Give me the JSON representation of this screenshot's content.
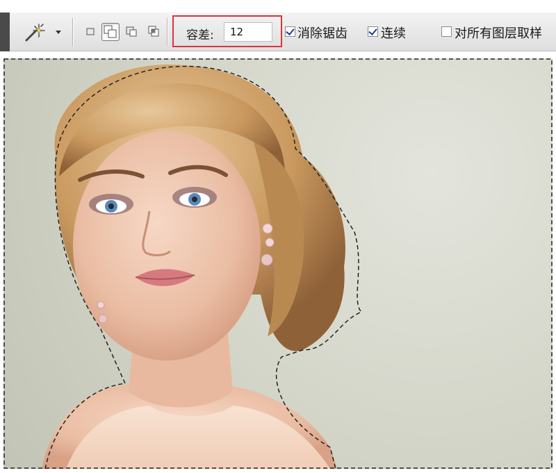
{
  "options_bar": {
    "tool_icon": "magic-wand-icon",
    "dropdown_icon": "chevron-down-icon",
    "selection_modes": [
      {
        "name": "new-selection",
        "active": false
      },
      {
        "name": "add-to-selection",
        "active": true
      },
      {
        "name": "subtract-from-selection",
        "active": false
      },
      {
        "name": "intersect-with-selection",
        "active": false
      }
    ],
    "tolerance_label": "容差:",
    "tolerance_value": "12",
    "highlight_color": "#d9343e",
    "anti_alias": {
      "label": "消除锯齿",
      "checked": true
    },
    "contiguous": {
      "label": "连续",
      "checked": true
    },
    "sample_all_layers": {
      "label": "对所有图层取样",
      "checked": false
    }
  },
  "canvas": {
    "background_color": "#cfd1c4",
    "content": "portrait-photo",
    "selection": "marching-ants"
  }
}
